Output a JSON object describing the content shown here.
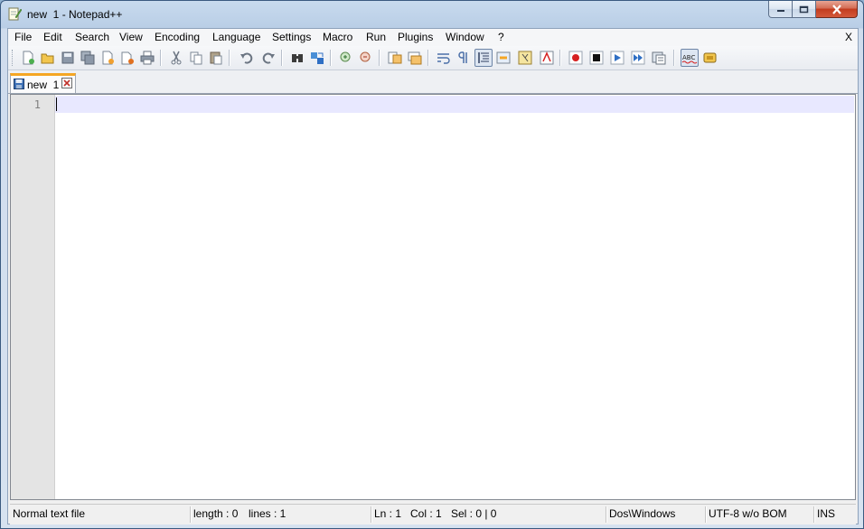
{
  "window": {
    "title": "new  1 - Notepad++",
    "app_icon": "notepad-pencil-icon",
    "caption_buttons": [
      "minimize-icon",
      "maximize-icon",
      "close-icon"
    ]
  },
  "menubar": {
    "items": [
      {
        "label": "File"
      },
      {
        "label": "Edit"
      },
      {
        "label": "Search"
      },
      {
        "label": "View"
      },
      {
        "label": "Encoding"
      },
      {
        "label": "Language"
      },
      {
        "label": "Settings"
      },
      {
        "label": "Macro"
      },
      {
        "label": "Run"
      },
      {
        "label": "Plugins"
      },
      {
        "label": "Window"
      },
      {
        "label": "?"
      }
    ],
    "close_label": "X"
  },
  "toolbar": {
    "icons": [
      "new-file-icon",
      "open-file-icon",
      "save-icon",
      "save-all-icon",
      "close-icon",
      "close-all-icon",
      "print-icon",
      "cut-icon",
      "copy-icon",
      "paste-icon",
      "undo-icon",
      "redo-icon",
      "find-icon",
      "replace-icon",
      "zoom-in-icon",
      "zoom-out-icon",
      "sync-vertical-icon",
      "sync-horizontal-icon",
      "word-wrap-icon",
      "show-all-characters-icon",
      "indent-guide-icon",
      "user-language-icon",
      "function-list-icon",
      "folder-as-workspace-icon",
      "record-macro-icon",
      "stop-record-icon",
      "play-macro-icon",
      "run-macro-multiple-icon",
      "save-macro-icon",
      "spell-check-icon",
      "plugin-icon"
    ],
    "accent_colors": {
      "orange": "#f5a623",
      "red": "#d62020",
      "blue": "#2f6fc4",
      "green": "#3a9a3a"
    }
  },
  "tabs": [
    {
      "label": "new  1",
      "icon": "saved-file-icon",
      "close_icon": "tab-close-icon",
      "active": true
    }
  ],
  "editor": {
    "line_numbers": [
      "1"
    ],
    "content": ""
  },
  "statusbar": {
    "file_type": "Normal text file",
    "length": "length : 0",
    "lines": "lines : 1",
    "ln": "Ln : 1",
    "col": "Col : 1",
    "sel": "Sel : 0 | 0",
    "eol": "Dos\\Windows",
    "encoding": "UTF-8 w/o BOM",
    "mode": "INS"
  }
}
